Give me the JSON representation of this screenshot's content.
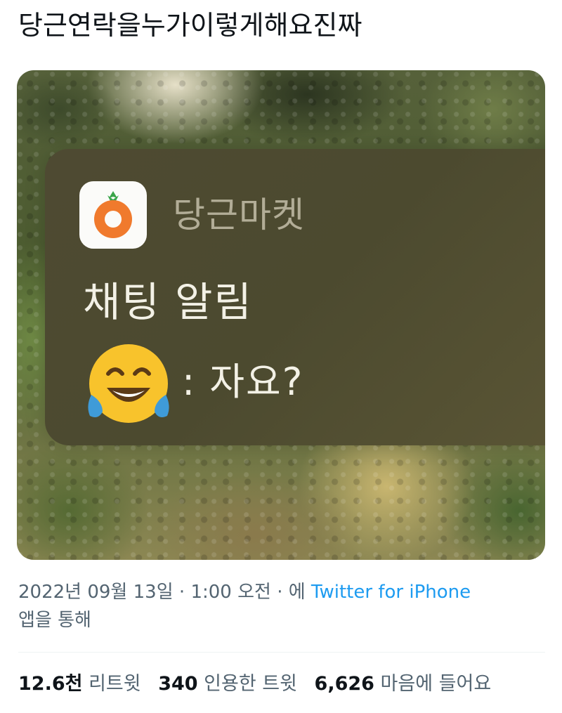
{
  "tweet": {
    "text": "당근연락을누가이렇게해요진짜"
  },
  "notification": {
    "app_icon": "carrot-market-icon",
    "app_name": "당근마켓",
    "title": "채팅 알림",
    "sender_emoji": "face-with-tears-of-joy",
    "message": ": 자요?"
  },
  "meta": {
    "date": "2022년 09월 13일",
    "separator1": " · ",
    "time": "1:00 오전",
    "separator2": " · ",
    "via_prefix": "에 ",
    "source": "Twitter for iPhone",
    "via_suffix": " 앱을 통해"
  },
  "stats": {
    "retweets_count": "12.6천",
    "retweets_label": "리트윗",
    "quotes_count": "340",
    "quotes_label": "인용한 트윗",
    "likes_count": "6,626",
    "likes_label": "마음에 들어요"
  },
  "colors": {
    "link": "#1d9bf0",
    "secondary_text": "#536471",
    "primary_text": "#0f1419",
    "carrot_orange": "#f07a2d"
  }
}
